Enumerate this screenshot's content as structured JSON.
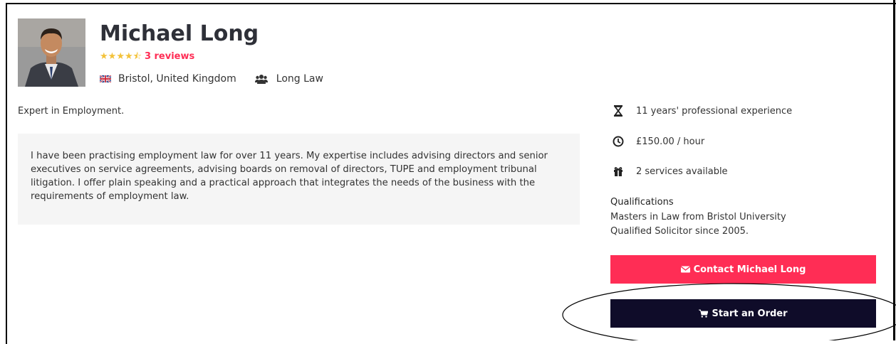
{
  "profile": {
    "name": "Michael Long",
    "rating_stars": 4.5,
    "reviews_label": "3 reviews",
    "location": "Bristol, United Kingdom",
    "firm": "Long Law",
    "tagline": "Expert in Employment.",
    "description": "I have been practising employment law for over 11 years. My expertise includes advising directors and senior executives on service agreements, advising boards on removal of directors, TUPE and employment tribunal litigation. I offer plain speaking and a practical approach that integrates the needs of the business with the requirements of employment law."
  },
  "sidebar": {
    "experience": "11 years' professional experience",
    "rate": "£150.00 / hour",
    "services": "2 services available",
    "qualifications_title": "Qualifications",
    "qualifications": [
      "Masters in Law from Bristol University",
      "Qualified Solicitor since 2005."
    ]
  },
  "actions": {
    "contact_label": "Contact Michael Long",
    "order_label": "Start an Order"
  },
  "icons": {
    "rating": "star-icon",
    "location": "uk-flag-icon",
    "firm": "users-icon",
    "experience": "hourglass-icon",
    "rate": "clock-icon",
    "services": "gift-icon",
    "contact": "envelope-icon",
    "order": "cart-icon"
  },
  "colors": {
    "accent": "#ff2d55",
    "dark_button": "#0f0c29",
    "star": "#f3c23a",
    "panel_bg": "#f5f5f5"
  }
}
